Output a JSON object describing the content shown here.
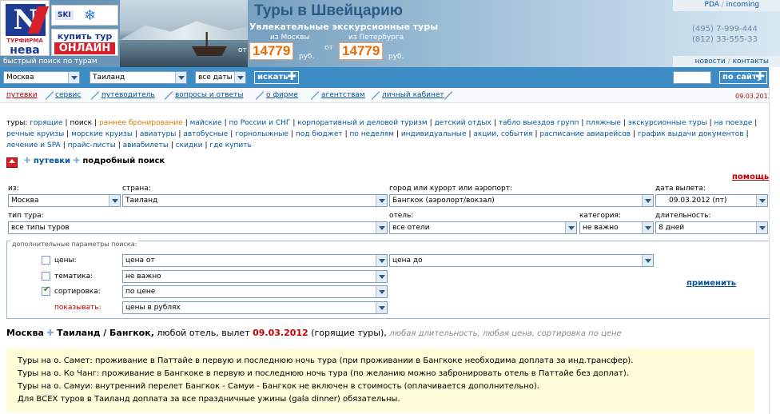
{
  "header": {
    "logo_top": "N",
    "logo_caption": "ТУРФИРМА",
    "logo_name": "нева",
    "ski": "SKI",
    "ski_flake": "❄",
    "buy_line1": "купить тур",
    "buy_line2": "ОНЛАЙН",
    "fast_search": "быстрый поиск по турам",
    "title": "Туры в Швейцарию",
    "subtitle": "Увлекательные экскурсионные туры",
    "from_msk": "из Москвы",
    "from_spb": "из Петербурга",
    "from_label": "от",
    "price_msk": "14779",
    "price_spb": "14779",
    "rub": "руб.",
    "pda": "PDA",
    "incoming": "incoming",
    "phone1": "(495) 7-999-444",
    "phone2": "(812) 33-555-33",
    "news": "новости",
    "contacts": "контакты"
  },
  "searchbar": {
    "city": "Москва",
    "country": "Таиланд",
    "dates": "все даты",
    "search_btn": "искать",
    "site_input": "",
    "site_btn": "по сайту"
  },
  "menu": {
    "items": [
      "путевки",
      "сервис",
      "путеводитель",
      "вопросы и ответы",
      "о фирме",
      "агентствам",
      "личный кабинет"
    ],
    "date": "09.03.2012"
  },
  "tours": {
    "label": "туры:",
    "items": [
      "горящие",
      "поиск",
      "раннее бронирование",
      "майские",
      "по России и СНГ",
      "корпоративный и деловой туризм",
      "детский отдых",
      "табло выездов групп",
      "пляжные",
      "экскурсионные туры",
      "на поезде",
      "речные круизы",
      "морские круизы",
      "авиатуры",
      "автобусные",
      "горнолыжные",
      "под бюджет",
      "по неделям",
      "индивидуальные",
      "акции, события",
      "расписание авиарейсов",
      "график выдачи документов",
      "лечение и SPA",
      "прайс-листы",
      "авиабилеты",
      "скидки",
      "где купить"
    ]
  },
  "crumb": {
    "link": "путевки",
    "current": "подробный поиск",
    "help": "помощь"
  },
  "form": {
    "from_label": "из:",
    "from_val": "Москва",
    "country_label": "страна:",
    "country_val": "Таиланд",
    "city_label": "город или курорт или аэропорт:",
    "city_val": "Бангкок (аэролорт/вокзал)",
    "date_label": "дата вылета:",
    "date_val": "09.03.2012 (пт)",
    "type_label": "тип тура:",
    "type_val": "все типы туров",
    "hotel_label": "отель:",
    "hotel_val": "все отели",
    "cat_label": "категория:",
    "cat_val": "не важно",
    "dur_label": "длительность:",
    "dur_val": "8 дней"
  },
  "extra": {
    "legend": "дополнительные параметры поиска:",
    "price_label": "цены:",
    "price_from": "цена от",
    "price_to": "цена до",
    "theme_label": "тематика:",
    "theme_val": "не важно",
    "sort_label": "сортировка:",
    "sort_val": "по цене",
    "show_label": "показывать:",
    "show_val": "цены в рублях",
    "apply": "применить"
  },
  "result": {
    "from": "Москва",
    "country": "Таиланд",
    "city": "/ Бангкок,",
    "rest": "любой отель, вылет",
    "date": "09.03.2012",
    "tag": "(горящие туры),",
    "grey": "любая длительность, любая цена, сортировка по цене"
  },
  "note": [
    "Туры на о. Самет: проживание в Паттайе в первую и последнюю ночь тура (при проживании в Бангкоке необходима доплата за инд.трансфер).",
    "Туры на о. Ко Чанг: проживание в Бангкоке в первую и последнюю ночь тура (по желанию можно забронировать отель в Паттайе без доплат).",
    "Туры на о. Самуи: внутренний перелет Бангкок - Самуи - Бангкок не включен в стоимость (оплачивается дополнительно).",
    "Для ВСЕХ туров в Таиланд доплата за все праздничные ужины (gala dinner) обязательны."
  ]
}
